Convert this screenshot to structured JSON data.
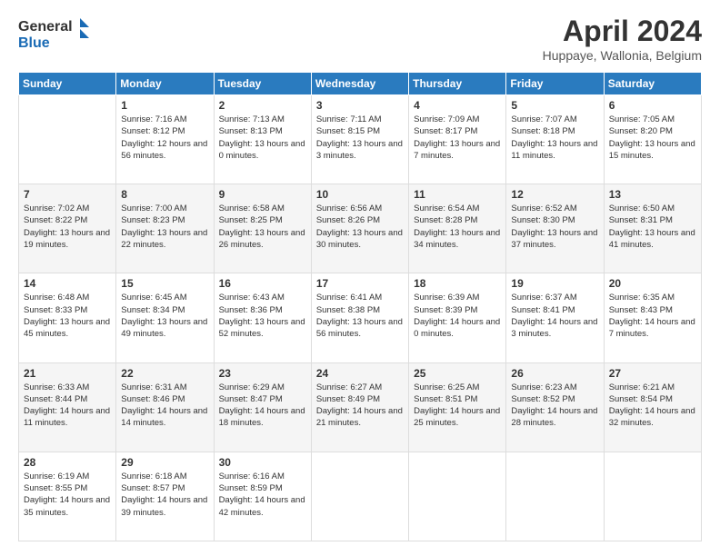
{
  "header": {
    "logo_line1": "General",
    "logo_line2": "Blue",
    "month_year": "April 2024",
    "location": "Huppaye, Wallonia, Belgium"
  },
  "weekdays": [
    "Sunday",
    "Monday",
    "Tuesday",
    "Wednesday",
    "Thursday",
    "Friday",
    "Saturday"
  ],
  "weeks": [
    [
      {
        "day": "",
        "sunrise": "",
        "sunset": "",
        "daylight": ""
      },
      {
        "day": "1",
        "sunrise": "Sunrise: 7:16 AM",
        "sunset": "Sunset: 8:12 PM",
        "daylight": "Daylight: 12 hours and 56 minutes."
      },
      {
        "day": "2",
        "sunrise": "Sunrise: 7:13 AM",
        "sunset": "Sunset: 8:13 PM",
        "daylight": "Daylight: 13 hours and 0 minutes."
      },
      {
        "day": "3",
        "sunrise": "Sunrise: 7:11 AM",
        "sunset": "Sunset: 8:15 PM",
        "daylight": "Daylight: 13 hours and 3 minutes."
      },
      {
        "day": "4",
        "sunrise": "Sunrise: 7:09 AM",
        "sunset": "Sunset: 8:17 PM",
        "daylight": "Daylight: 13 hours and 7 minutes."
      },
      {
        "day": "5",
        "sunrise": "Sunrise: 7:07 AM",
        "sunset": "Sunset: 8:18 PM",
        "daylight": "Daylight: 13 hours and 11 minutes."
      },
      {
        "day": "6",
        "sunrise": "Sunrise: 7:05 AM",
        "sunset": "Sunset: 8:20 PM",
        "daylight": "Daylight: 13 hours and 15 minutes."
      }
    ],
    [
      {
        "day": "7",
        "sunrise": "Sunrise: 7:02 AM",
        "sunset": "Sunset: 8:22 PM",
        "daylight": "Daylight: 13 hours and 19 minutes."
      },
      {
        "day": "8",
        "sunrise": "Sunrise: 7:00 AM",
        "sunset": "Sunset: 8:23 PM",
        "daylight": "Daylight: 13 hours and 22 minutes."
      },
      {
        "day": "9",
        "sunrise": "Sunrise: 6:58 AM",
        "sunset": "Sunset: 8:25 PM",
        "daylight": "Daylight: 13 hours and 26 minutes."
      },
      {
        "day": "10",
        "sunrise": "Sunrise: 6:56 AM",
        "sunset": "Sunset: 8:26 PM",
        "daylight": "Daylight: 13 hours and 30 minutes."
      },
      {
        "day": "11",
        "sunrise": "Sunrise: 6:54 AM",
        "sunset": "Sunset: 8:28 PM",
        "daylight": "Daylight: 13 hours and 34 minutes."
      },
      {
        "day": "12",
        "sunrise": "Sunrise: 6:52 AM",
        "sunset": "Sunset: 8:30 PM",
        "daylight": "Daylight: 13 hours and 37 minutes."
      },
      {
        "day": "13",
        "sunrise": "Sunrise: 6:50 AM",
        "sunset": "Sunset: 8:31 PM",
        "daylight": "Daylight: 13 hours and 41 minutes."
      }
    ],
    [
      {
        "day": "14",
        "sunrise": "Sunrise: 6:48 AM",
        "sunset": "Sunset: 8:33 PM",
        "daylight": "Daylight: 13 hours and 45 minutes."
      },
      {
        "day": "15",
        "sunrise": "Sunrise: 6:45 AM",
        "sunset": "Sunset: 8:34 PM",
        "daylight": "Daylight: 13 hours and 49 minutes."
      },
      {
        "day": "16",
        "sunrise": "Sunrise: 6:43 AM",
        "sunset": "Sunset: 8:36 PM",
        "daylight": "Daylight: 13 hours and 52 minutes."
      },
      {
        "day": "17",
        "sunrise": "Sunrise: 6:41 AM",
        "sunset": "Sunset: 8:38 PM",
        "daylight": "Daylight: 13 hours and 56 minutes."
      },
      {
        "day": "18",
        "sunrise": "Sunrise: 6:39 AM",
        "sunset": "Sunset: 8:39 PM",
        "daylight": "Daylight: 14 hours and 0 minutes."
      },
      {
        "day": "19",
        "sunrise": "Sunrise: 6:37 AM",
        "sunset": "Sunset: 8:41 PM",
        "daylight": "Daylight: 14 hours and 3 minutes."
      },
      {
        "day": "20",
        "sunrise": "Sunrise: 6:35 AM",
        "sunset": "Sunset: 8:43 PM",
        "daylight": "Daylight: 14 hours and 7 minutes."
      }
    ],
    [
      {
        "day": "21",
        "sunrise": "Sunrise: 6:33 AM",
        "sunset": "Sunset: 8:44 PM",
        "daylight": "Daylight: 14 hours and 11 minutes."
      },
      {
        "day": "22",
        "sunrise": "Sunrise: 6:31 AM",
        "sunset": "Sunset: 8:46 PM",
        "daylight": "Daylight: 14 hours and 14 minutes."
      },
      {
        "day": "23",
        "sunrise": "Sunrise: 6:29 AM",
        "sunset": "Sunset: 8:47 PM",
        "daylight": "Daylight: 14 hours and 18 minutes."
      },
      {
        "day": "24",
        "sunrise": "Sunrise: 6:27 AM",
        "sunset": "Sunset: 8:49 PM",
        "daylight": "Daylight: 14 hours and 21 minutes."
      },
      {
        "day": "25",
        "sunrise": "Sunrise: 6:25 AM",
        "sunset": "Sunset: 8:51 PM",
        "daylight": "Daylight: 14 hours and 25 minutes."
      },
      {
        "day": "26",
        "sunrise": "Sunrise: 6:23 AM",
        "sunset": "Sunset: 8:52 PM",
        "daylight": "Daylight: 14 hours and 28 minutes."
      },
      {
        "day": "27",
        "sunrise": "Sunrise: 6:21 AM",
        "sunset": "Sunset: 8:54 PM",
        "daylight": "Daylight: 14 hours and 32 minutes."
      }
    ],
    [
      {
        "day": "28",
        "sunrise": "Sunrise: 6:19 AM",
        "sunset": "Sunset: 8:55 PM",
        "daylight": "Daylight: 14 hours and 35 minutes."
      },
      {
        "day": "29",
        "sunrise": "Sunrise: 6:18 AM",
        "sunset": "Sunset: 8:57 PM",
        "daylight": "Daylight: 14 hours and 39 minutes."
      },
      {
        "day": "30",
        "sunrise": "Sunrise: 6:16 AM",
        "sunset": "Sunset: 8:59 PM",
        "daylight": "Daylight: 14 hours and 42 minutes."
      },
      {
        "day": "",
        "sunrise": "",
        "sunset": "",
        "daylight": ""
      },
      {
        "day": "",
        "sunrise": "",
        "sunset": "",
        "daylight": ""
      },
      {
        "day": "",
        "sunrise": "",
        "sunset": "",
        "daylight": ""
      },
      {
        "day": "",
        "sunrise": "",
        "sunset": "",
        "daylight": ""
      }
    ]
  ]
}
